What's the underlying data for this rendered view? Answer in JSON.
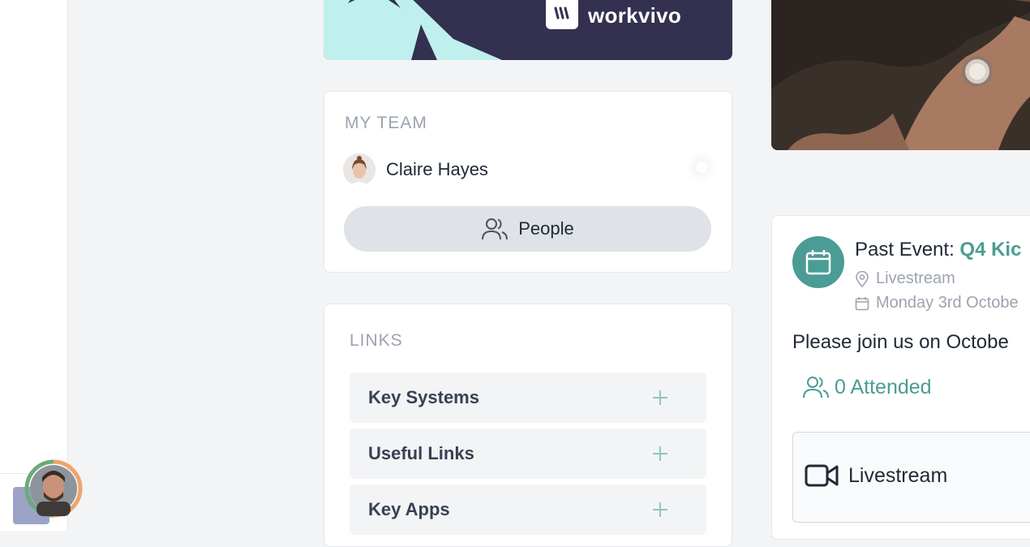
{
  "brand": {
    "name": "workvivo"
  },
  "my_team": {
    "title": "MY TEAM",
    "member_name": "Claire Hayes",
    "people_button": "People"
  },
  "links": {
    "title": "LINKS",
    "items": [
      {
        "label": "Key Systems"
      },
      {
        "label": "Useful Links"
      },
      {
        "label": "Key Apps"
      }
    ]
  },
  "event": {
    "prefix": "Past Event:",
    "name": "Q4 Kic",
    "location": "Livestream",
    "date": "Monday 3rd Octobe",
    "description": "Please join us on Octobe",
    "attended": "0 Attended",
    "stream_label": "Livestream"
  },
  "colors": {
    "accent": "#4b9c95",
    "banner": "#33314f",
    "banner_stroke": "#bff0ee"
  }
}
